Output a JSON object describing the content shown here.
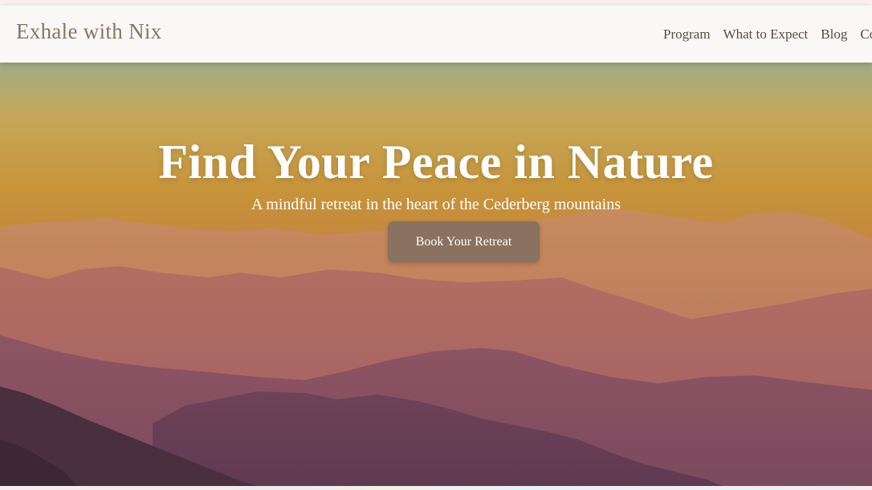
{
  "brand": {
    "name": "Exhale with Nix"
  },
  "nav": {
    "items": [
      {
        "label": "Program"
      },
      {
        "label": "What to Expect"
      },
      {
        "label": "Blog"
      },
      {
        "label": "Co"
      }
    ]
  },
  "hero": {
    "title": "Find Your Peace in Nature",
    "subtitle": "A mindful retreat in the heart of the Cederberg mountains",
    "cta_label": "Book Your Retreat"
  },
  "colors": {
    "brand_text": "#8b7562",
    "nav_text": "#5a4a3e",
    "cta_background": "#8b715f",
    "sky_top": "#9eab86",
    "sky_mid": "#c99a3c",
    "mountain_far": "#c37a5e",
    "mountain_mid": "#9e5a62",
    "mountain_near": "#6a3e52"
  }
}
